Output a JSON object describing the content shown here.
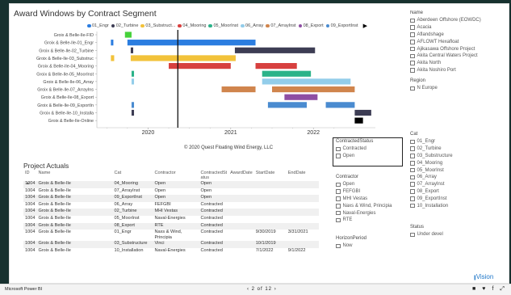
{
  "chart_title": "Award Windows by Contract Segment",
  "chart_data": {
    "type": "gantt",
    "title": "Award Windows by Contract Segment",
    "legend": [
      {
        "name": "01_Engr",
        "color": "#2b7de0"
      },
      {
        "name": "02_Turbine",
        "color": "#3d3d54"
      },
      {
        "name": "03_Substruct...",
        "color": "#f2c23a"
      },
      {
        "name": "04_Mooring",
        "color": "#d7403f"
      },
      {
        "name": "05_MoorInst",
        "color": "#2bb389"
      },
      {
        "name": "06_Array",
        "color": "#93cdea"
      },
      {
        "name": "07_ArrayInst",
        "color": "#d0854d"
      },
      {
        "name": "08_Export",
        "color": "#8e4ea3"
      },
      {
        "name": "09_ExportInst",
        "color": "#4a8bd0"
      }
    ],
    "legend_more_glyph": "▶",
    "x_ticks": [
      "2020",
      "2021",
      "2022"
    ],
    "rows": [
      {
        "label": "Groix & Belle-Ile-FID",
        "bars": [
          {
            "series": 4,
            "start": 2019.72,
            "end": 2019.8,
            "color": "#46d23a"
          }
        ]
      },
      {
        "label": "Groix & Belle-Ile-01_Engr",
        "bars": [
          {
            "series": 0,
            "start": 2019.55,
            "end": 2019.58
          },
          {
            "series": 0,
            "start": 2019.75,
            "end": 2021.3
          }
        ]
      },
      {
        "label": "Groix & Belle-Ile-02_Turbine",
        "bars": [
          {
            "series": 1,
            "start": 2019.79,
            "end": 2019.82
          },
          {
            "series": 1,
            "start": 2021.05,
            "end": 2022.02
          }
        ]
      },
      {
        "label": "Groix & Belle-Ile-03_Substruc",
        "bars": [
          {
            "series": 2,
            "start": 2019.55,
            "end": 2019.59
          },
          {
            "series": 2,
            "start": 2019.79,
            "end": 2021.06
          }
        ]
      },
      {
        "label": "Groix & Belle-Ile-04_Mooring",
        "bars": [
          {
            "series": 3,
            "start": 2020.25,
            "end": 2021.0
          },
          {
            "series": 3,
            "start": 2021.3,
            "end": 2021.8
          }
        ]
      },
      {
        "label": "Groix & Belle-Ile-05_MoorInst",
        "bars": [
          {
            "series": 4,
            "start": 2019.8,
            "end": 2019.83
          },
          {
            "series": 4,
            "start": 2021.38,
            "end": 2021.97
          }
        ]
      },
      {
        "label": "Groix & Belle-Ile-06_Array",
        "bars": [
          {
            "series": 5,
            "start": 2019.8,
            "end": 2019.83
          },
          {
            "series": 5,
            "start": 2021.38,
            "end": 2022.45
          }
        ]
      },
      {
        "label": "Groix & Belle-Ile-07_ArrayIns",
        "bars": [
          {
            "series": 6,
            "start": 2020.89,
            "end": 2021.3
          },
          {
            "series": 6,
            "start": 2021.5,
            "end": 2022.5
          }
        ]
      },
      {
        "label": "Groix & Belle-Ile-08_Export",
        "bars": [
          {
            "series": 7,
            "start": 2021.65,
            "end": 2022.05
          }
        ]
      },
      {
        "label": "Groix & Belle-Ile-09_ExportIn",
        "bars": [
          {
            "series": 8,
            "start": 2019.8,
            "end": 2019.83
          },
          {
            "series": 8,
            "start": 2021.45,
            "end": 2021.92
          },
          {
            "series": 8,
            "start": 2022.15,
            "end": 2022.5
          }
        ]
      },
      {
        "label": "Groix & Belle-Ile-10_Installa",
        "bars": [
          {
            "series": 1,
            "start": 2019.8,
            "end": 2019.83
          },
          {
            "series": 1,
            "start": 2022.5,
            "end": 2022.7
          }
        ]
      },
      {
        "label": "Groix & Belle-Ile-Online",
        "bars": [
          {
            "series": 1,
            "start": 2022.5,
            "end": 2022.6,
            "color": "#000000"
          }
        ]
      }
    ],
    "x_range": [
      2019.4,
      2022.75
    ],
    "today_line": 2020.36
  },
  "copyright": "© 2020 Quest Floating Wind Energy, LLC",
  "project_actuals": {
    "title": "Project Actuals",
    "columns": [
      "ID",
      "Name",
      "Cat",
      "Contractor",
      "ContractedSt atus",
      "AwardDate",
      "StartDate",
      "EndDate"
    ],
    "sort_glyph": "▲",
    "rows": [
      [
        "1004",
        "Groix & Belle-Ile",
        "04_Mooring",
        "Open",
        "Open",
        "",
        "",
        ""
      ],
      [
        "1004",
        "Groix & Belle-Ile",
        "07_ArrayInst",
        "Open",
        "Open",
        "",
        "",
        ""
      ],
      [
        "1004",
        "Groix & Belle-Ile",
        "09_ExportInst",
        "Open",
        "Open",
        "",
        "",
        ""
      ],
      [
        "1004",
        "Groix & Belle-Ile",
        "06_Array",
        "FEFGBI",
        "Contracted",
        "",
        "",
        ""
      ],
      [
        "1004",
        "Groix & Belle-Ile",
        "02_Turbine",
        "MHI Vestas",
        "Contracted",
        "",
        "",
        ""
      ],
      [
        "1004",
        "Groix & Belle-Ile",
        "05_MoorInst",
        "Naval-Energies",
        "Contracted",
        "",
        "",
        ""
      ],
      [
        "1004",
        "Groix & Belle-Ile",
        "08_Export",
        "RTE",
        "Contracted",
        "",
        "",
        ""
      ],
      [
        "1004",
        "Groix & Belle-Ile",
        "01_Engr",
        "Naxs & Wind, Principia",
        "Contracted",
        "",
        "9/30/2019",
        "3/31/2021"
      ],
      [
        "1004",
        "Groix & Belle-Ile",
        "03_Substructure",
        "Vinci",
        "Contracted",
        "",
        "10/1/2019",
        ""
      ],
      [
        "1004",
        "Groix & Belle-Ile",
        "10_Installation",
        "Naval-Energies",
        "Contracted",
        "",
        "7/1/2022",
        "9/1/2022"
      ]
    ]
  },
  "slicers": {
    "name": {
      "title": "Name",
      "options": [
        "Aberdeen Offshore (EOWDC)",
        "Acacia",
        "Aflandshage",
        "AFLOWT Hexafloat",
        "Ajikasawa Offshore Project",
        "Akita Central Waters Project",
        "Akita North",
        "Akita Noshiro Port"
      ]
    },
    "region": {
      "title": "Region",
      "options": [
        "N Europe"
      ]
    },
    "cat": {
      "title": "Cat",
      "options": [
        "01_Engr",
        "02_Turbine",
        "03_Substructure",
        "04_Mooring",
        "05_MoorInst",
        "06_Array",
        "07_ArrayInst",
        "08_Export",
        "09_ExportInst",
        "10_Installation"
      ]
    },
    "contracted_status": {
      "title": "ContractedStatus",
      "options": [
        "Contracted",
        "Open"
      ]
    },
    "contractor": {
      "title": "Contractor",
      "options": [
        "Open",
        "FEFGBI",
        "MHI Vestas",
        "Naxs & Wind, Principia",
        "Naval-Energies",
        "RTE"
      ]
    },
    "horizon_period": {
      "title": "HorizonPeriod",
      "options": [
        "Now"
      ]
    },
    "status": {
      "title": "Status",
      "options": [
        "Under devel"
      ]
    }
  },
  "statusbar": {
    "brand": "Microsoft Power BI",
    "prev": "‹",
    "page": "2 of 12",
    "next": "›",
    "icons": [
      "■",
      "♥",
      "f",
      "⤢"
    ]
  },
  "vision_logo": {
    "bars": "|||",
    "text": "Vision"
  }
}
